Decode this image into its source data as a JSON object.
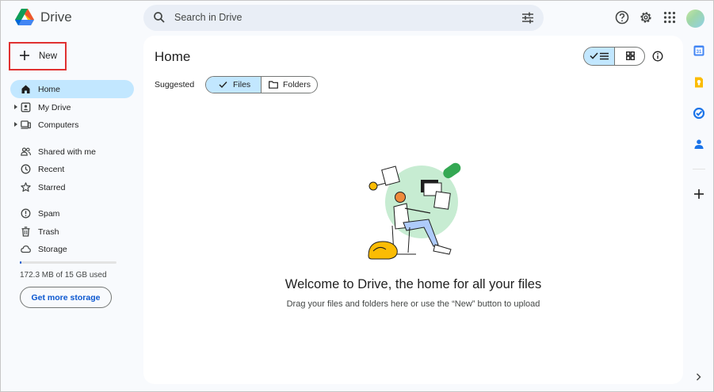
{
  "header": {
    "app_title": "Drive",
    "search_placeholder": "Search in Drive"
  },
  "icons": {
    "logo": "google-drive-logo",
    "search": "search-icon",
    "filter": "tune-icon",
    "help": "help-icon",
    "settings": "gear-icon",
    "apps": "apps-grid-icon"
  },
  "sidebar": {
    "new_label": "New",
    "items": [
      {
        "label": "Home",
        "icon": "home-icon",
        "active": true
      },
      {
        "label": "My Drive",
        "icon": "my-drive-icon",
        "expandable": true
      },
      {
        "label": "Computers",
        "icon": "computers-icon",
        "expandable": true
      },
      {
        "label": "Shared with me",
        "icon": "shared-icon"
      },
      {
        "label": "Recent",
        "icon": "clock-icon"
      },
      {
        "label": "Starred",
        "icon": "star-icon"
      },
      {
        "label": "Spam",
        "icon": "spam-icon"
      },
      {
        "label": "Trash",
        "icon": "trash-icon"
      },
      {
        "label": "Storage",
        "icon": "cloud-icon"
      }
    ],
    "storage_used_fraction": 0.012,
    "storage_text": "172.3 MB of 15 GB used",
    "more_storage_label": "Get more storage"
  },
  "main": {
    "title": "Home",
    "suggested_label": "Suggested",
    "chips": {
      "files": "Files",
      "folders": "Folders"
    },
    "welcome_title": "Welcome to Drive, the home for all your files",
    "welcome_hint": "Drag your files and folders here or use the “New” button to upload"
  },
  "side_panel": {
    "apps": [
      "calendar-icon",
      "keep-icon",
      "tasks-icon",
      "contacts-icon"
    ],
    "add": "add-icon",
    "collapse": "chevron-right-icon"
  },
  "colors": {
    "accent": "#0b57d0",
    "selected": "#c2e7ff",
    "search_bg": "#e9eef6",
    "page_bg": "#f8fafd",
    "highlight_box": "#e03131"
  }
}
